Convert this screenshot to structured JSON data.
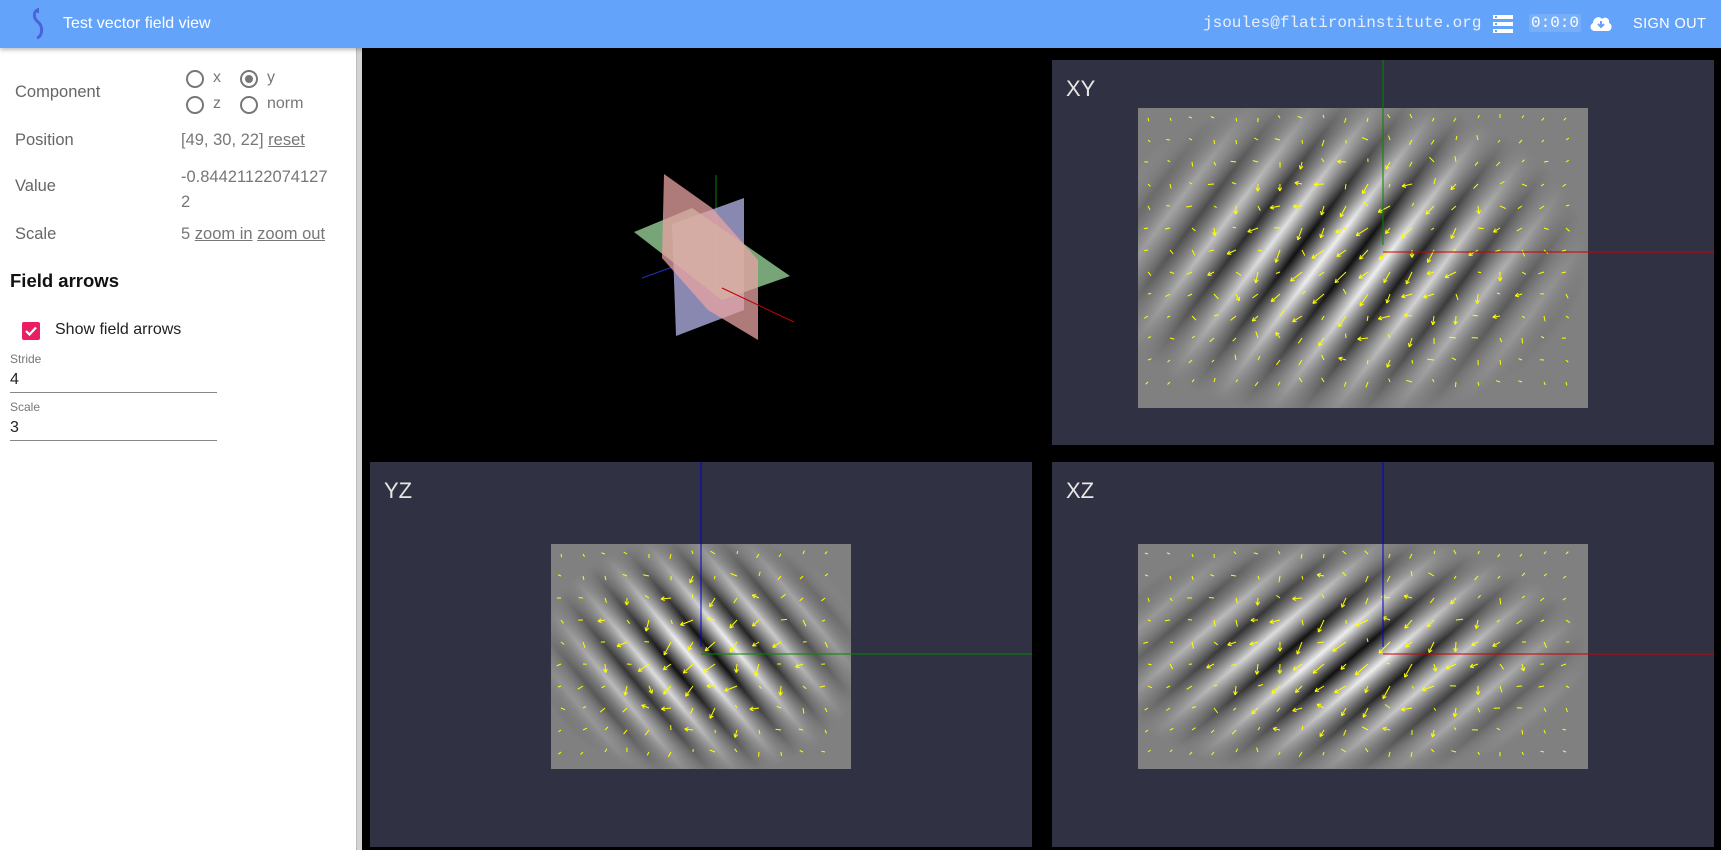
{
  "header": {
    "app_title": "Test vector field view",
    "user_email": "jsoules@flatironinstitute.org",
    "timer": "0:0:0",
    "signout_label": "SIGN OUT",
    "icons": [
      "logo-icon",
      "server-icon",
      "cloud-download-icon"
    ],
    "colors": {
      "bar": "#64a3fa"
    }
  },
  "sidebar": {
    "component": {
      "label": "Component",
      "options": [
        "x",
        "y",
        "z",
        "norm"
      ],
      "selected": "y"
    },
    "position": {
      "label": "Position",
      "value": "[49, 30, 22]",
      "reset_label": "reset"
    },
    "value": {
      "label": "Value",
      "line1": "-0.84421122074127",
      "line2": "2"
    },
    "scale": {
      "label": "Scale",
      "value": "5",
      "zoom_in_label": "zoom in",
      "zoom_out_label": "zoom out"
    },
    "field_arrows": {
      "title": "Field arrows",
      "show_label": "Show field arrows",
      "show_checked": true,
      "stride_label": "Stride",
      "stride_value": "4",
      "scale_label": "Scale",
      "scale_value": "3"
    }
  },
  "views": {
    "xy_label": "XY",
    "yz_label": "YZ",
    "xz_label": "XZ",
    "colors": {
      "panel_bg": "#313144",
      "arrow": "#ffff00",
      "x_axis": "#cc0000",
      "y_axis": "#008800",
      "z_axis": "#0000cc"
    }
  }
}
